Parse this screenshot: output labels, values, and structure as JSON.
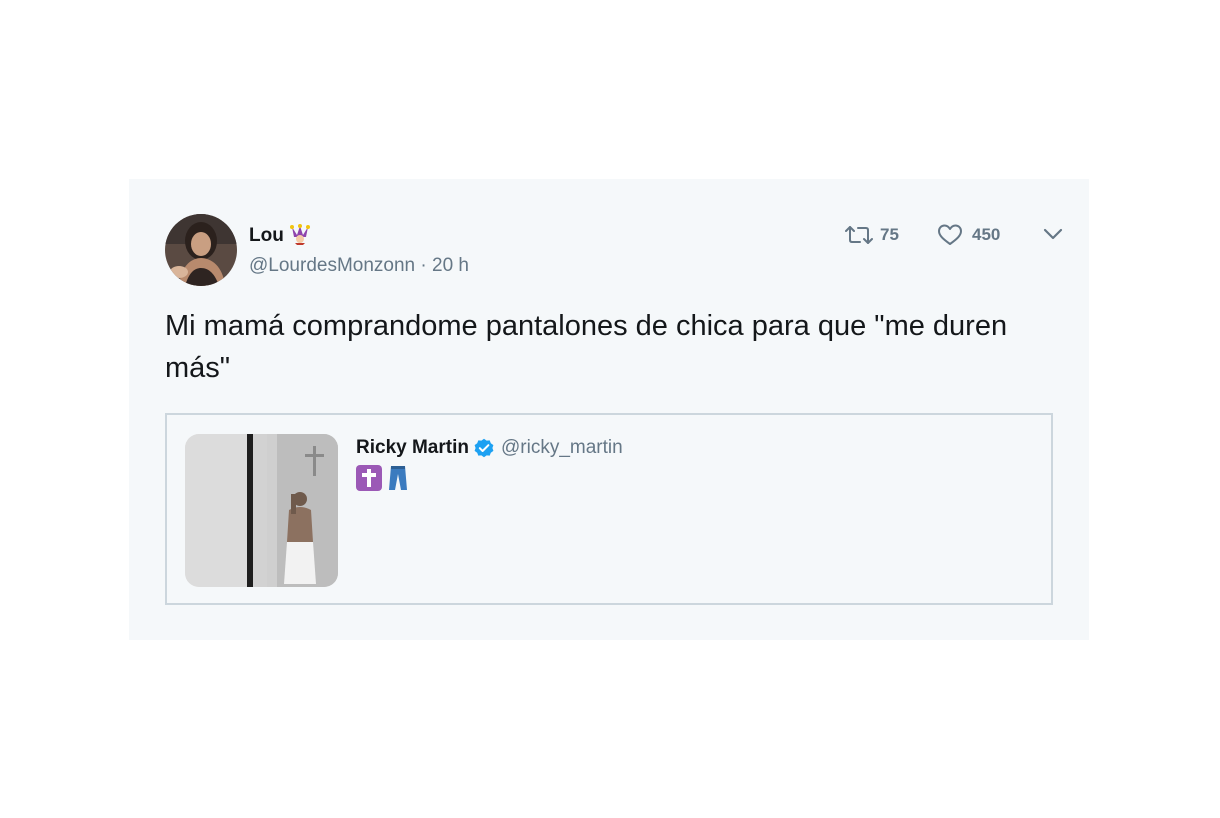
{
  "tweet": {
    "author_name": "Lou",
    "name_emoji_icon": "jester-icon",
    "author_handle": "@LourdesMonzonn",
    "meta_separator": " · ",
    "time_ago": "20 h",
    "retweet_count": "75",
    "like_count": "450",
    "text": "Mi mamá comprandome pantalones de chica para que \"me duren más\""
  },
  "quoted_tweet": {
    "author_name": "Ricky Martin",
    "verified_icon": "verified-badge-icon",
    "author_handle": "@ricky_martin",
    "emojis": [
      "latin-cross-icon",
      "jeans-icon"
    ]
  },
  "colors": {
    "card_background": "#f5f8fa",
    "text_primary": "#14171a",
    "text_secondary": "#657786",
    "border": "#ccd6dd",
    "verified_blue": "#1da1f2",
    "cross_purple": "#9b59b6",
    "jeans_blue": "#3b7bbf"
  }
}
